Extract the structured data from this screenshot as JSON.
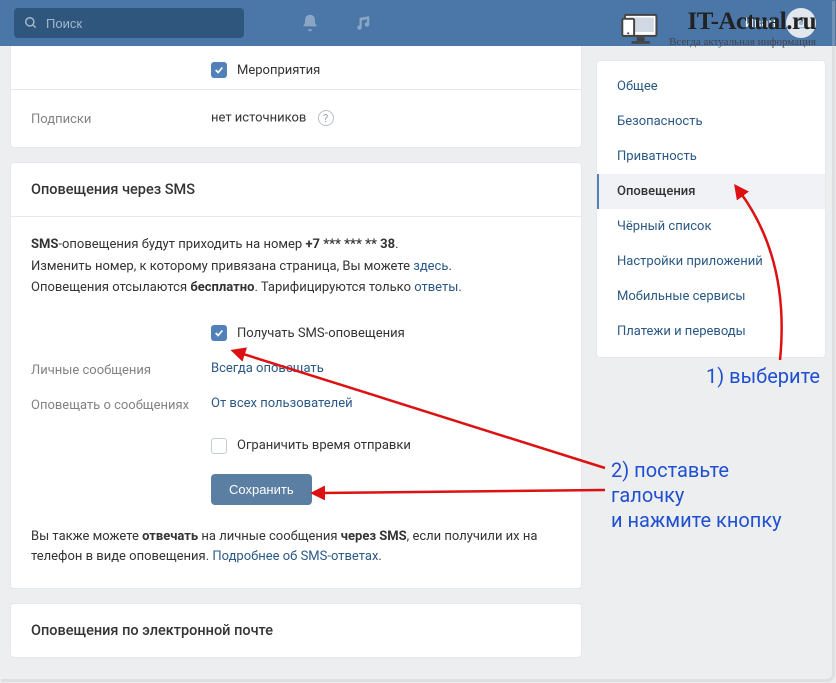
{
  "header": {
    "search_placeholder": "Поиск",
    "username": "Иван"
  },
  "watermark": {
    "title": "IT-Actual.ru",
    "subtitle": "Всегда актуальная информация"
  },
  "card1": {
    "events_label": "Мероприятия",
    "subs_label": "Подписки",
    "subs_value": "нет источников"
  },
  "sms": {
    "title": "Оповещения через SMS",
    "p1_a": "SMS",
    "p1_b": "-оповещения будут приходить на номер ",
    "p1_num": "+7 *** *** ** 38",
    "p1_c": ".",
    "p2_a": "Изменить номер, к которому привязана страница, Вы можете ",
    "p2_link": "здесь",
    "p2_b": ".",
    "p3_a": "Оповещения отсылаются ",
    "p3_bold": "бесплатно",
    "p3_b": ". Тарифицируются только ",
    "p3_link": "ответы",
    "p3_c": ".",
    "receive_label": "Получать SMS-оповещения",
    "pm_label": "Личные сообщения",
    "pm_value": "Всегда оповещать",
    "notify_about_label": "Оповещать о сообщениях",
    "notify_about_value": "От всех пользователей",
    "limit_label": "Ограничить время отправки",
    "save": "Сохранить",
    "foot_a": "Вы также можете ",
    "foot_b": "отвечать",
    "foot_c": " на личные сообщения ",
    "foot_d": "через SMS",
    "foot_e": ", если получили их на телефон в виде оповещения. ",
    "foot_link": "Подробнее об SMS-ответах",
    "foot_f": "."
  },
  "email": {
    "title": "Оповещения по электронной почте"
  },
  "sidebar": {
    "items": [
      "Общее",
      "Безопасность",
      "Приватность",
      "Оповещения",
      "Чёрный список",
      "Настройки приложений",
      "Мобильные сервисы",
      "Платежи и переводы"
    ],
    "active_index": 3
  },
  "annotations": {
    "step1": "1) выберите",
    "step2": "2) поставьте\nгалочку\nи нажмите кнопку"
  }
}
